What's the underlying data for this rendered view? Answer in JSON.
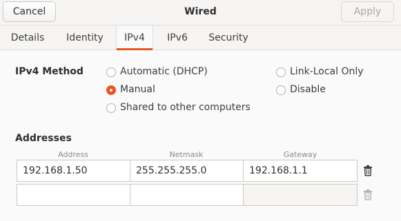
{
  "header": {
    "cancel_label": "Cancel",
    "title": "Wired",
    "apply_label": "Apply"
  },
  "tabs": [
    {
      "label": "Details",
      "active": false
    },
    {
      "label": "Identity",
      "active": false
    },
    {
      "label": "IPv4",
      "active": true
    },
    {
      "label": "IPv6",
      "active": false
    },
    {
      "label": "Security",
      "active": false
    }
  ],
  "ipv4_method": {
    "label": "IPv4 Method",
    "options": [
      {
        "label": "Automatic (DHCP)",
        "selected": false
      },
      {
        "label": "Manual",
        "selected": true
      },
      {
        "label": "Shared to other computers",
        "selected": false
      },
      {
        "label": "Link-Local Only",
        "selected": false
      },
      {
        "label": "Disable",
        "selected": false
      }
    ]
  },
  "addresses": {
    "label": "Addresses",
    "columns": [
      "Address",
      "Netmask",
      "Gateway"
    ],
    "rows": [
      {
        "address": "192.168.1.50",
        "netmask": "255.255.255.0",
        "gateway": "192.168.1.1"
      },
      {
        "address": "",
        "netmask": "",
        "gateway": ""
      }
    ]
  },
  "icons": {
    "delete": "trash-icon"
  },
  "colors": {
    "accent": "#e95420"
  }
}
